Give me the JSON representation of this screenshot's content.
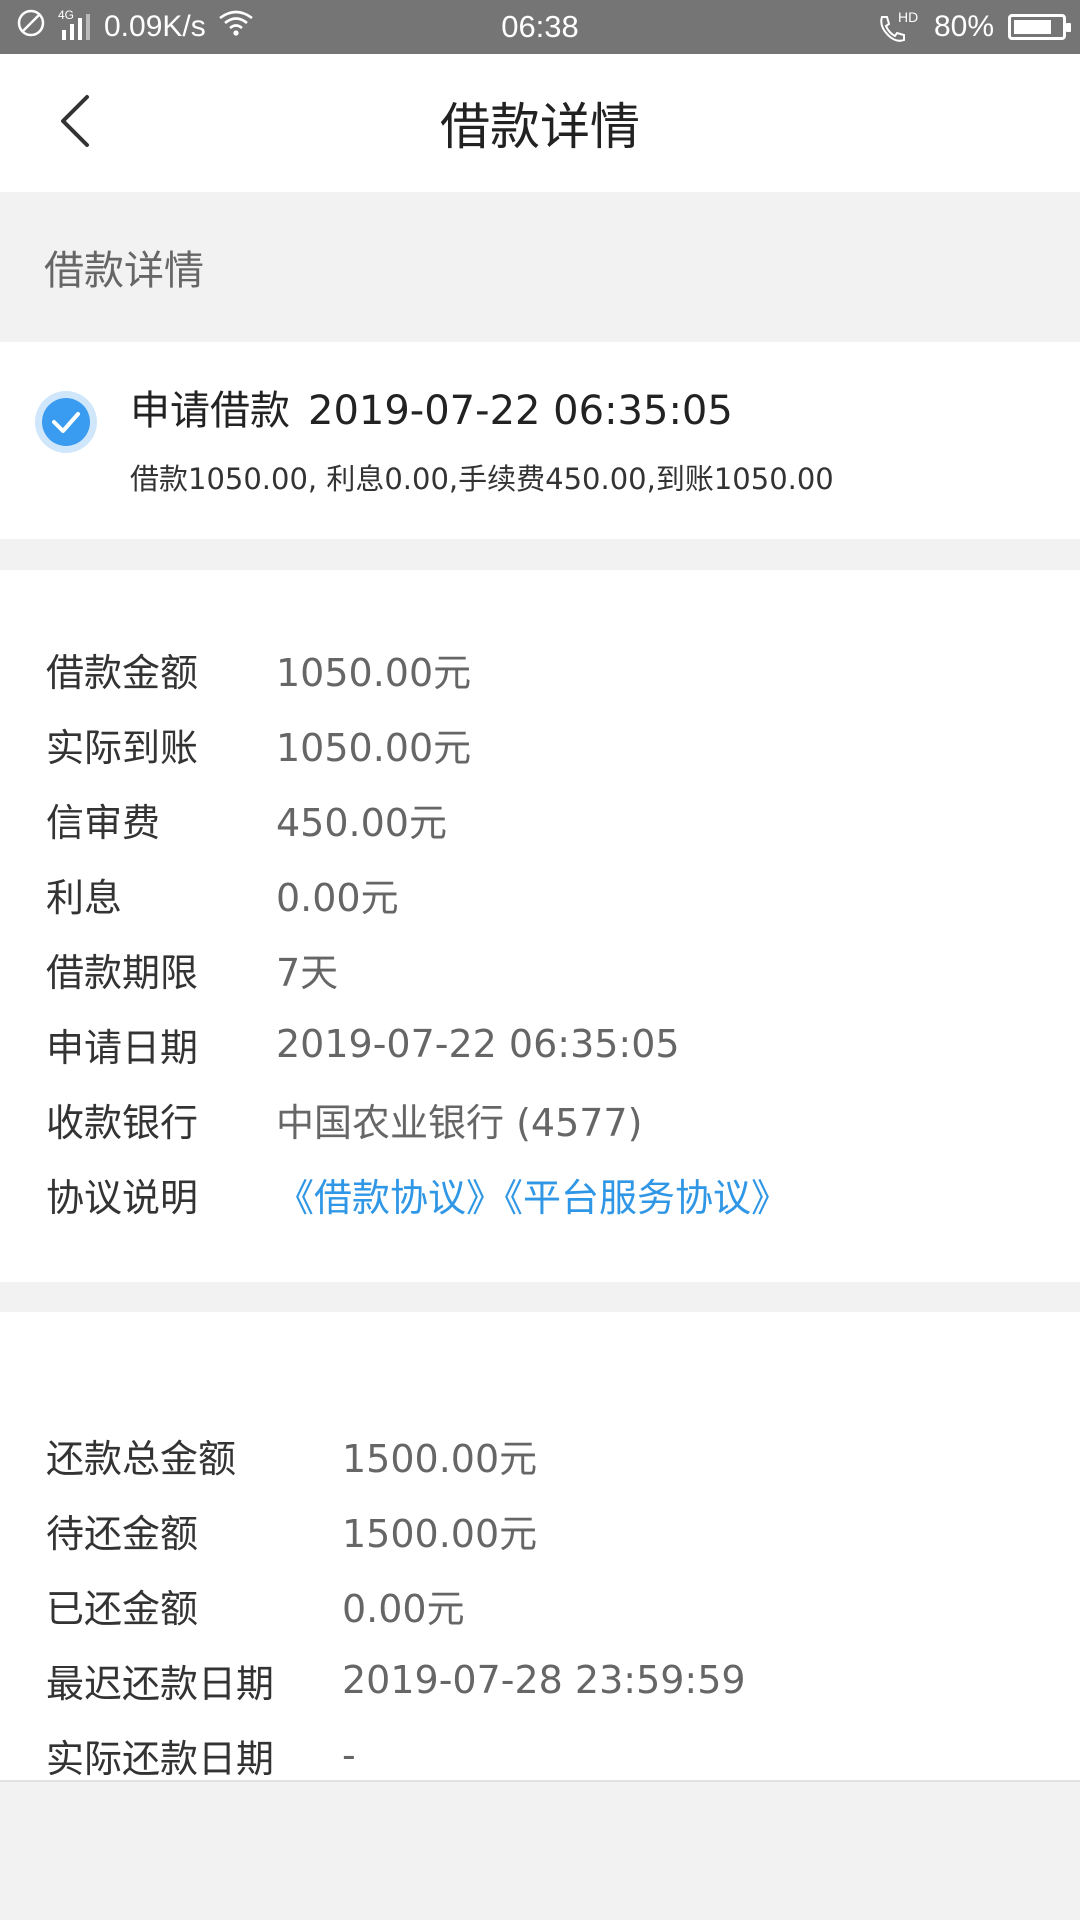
{
  "status_bar": {
    "network": "4G",
    "speed": "0.09K/s",
    "time": "06:38",
    "hd": "HD",
    "battery": "80%",
    "battery_level": 0.8
  },
  "nav": {
    "title": "借款详情"
  },
  "section": {
    "title": "借款详情"
  },
  "application": {
    "title": "申请借款",
    "datetime": "2019-07-22 06:35:05",
    "detail": "借款1050.00, 利息0.00,手续费450.00,到账1050.00"
  },
  "loan_details": [
    {
      "label": "借款金额",
      "value": "1050.00元"
    },
    {
      "label": "实际到账",
      "value": "1050.00元"
    },
    {
      "label": "信审费",
      "value": "450.00元"
    },
    {
      "label": "利息",
      "value": "0.00元"
    },
    {
      "label": "借款期限",
      "value": "7天"
    },
    {
      "label": "申请日期",
      "value": "2019-07-22 06:35:05"
    },
    {
      "label": "收款银行",
      "value": "中国农业银行 (4577)"
    }
  ],
  "agreement": {
    "label": "协议说明",
    "loan_agreement": "《借款协议》",
    "platform_agreement": "《平台服务协议》"
  },
  "repayment": [
    {
      "label": "还款总金额",
      "value": "1500.00元"
    },
    {
      "label": "待还金额",
      "value": "1500.00元"
    },
    {
      "label": "已还金额",
      "value": "0.00元"
    },
    {
      "label": "最迟还款日期",
      "value": "2019-07-28 23:59:59"
    },
    {
      "label": "实际还款日期",
      "value": "-"
    }
  ],
  "colors": {
    "accent": "#2f97e5",
    "status_bar": "#757575",
    "background": "#f2f2f2"
  }
}
